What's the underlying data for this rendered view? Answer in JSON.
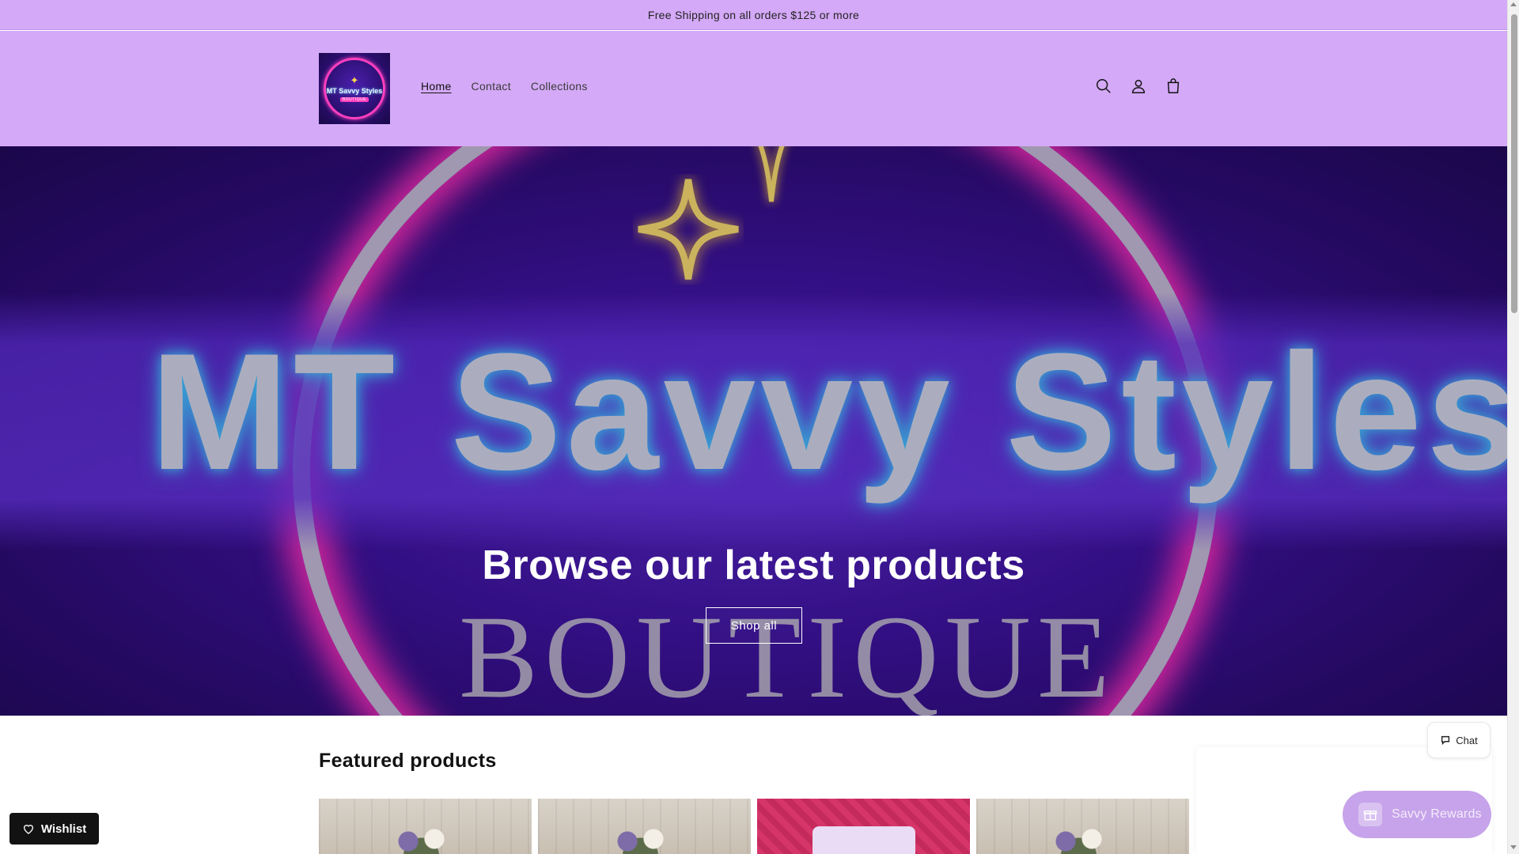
{
  "announcement": {
    "text": "Free Shipping on all orders $125 or more"
  },
  "header": {
    "logo": {
      "brand": "MT Savvy Styles",
      "sub": "BOUTIQUE"
    },
    "nav": [
      {
        "label": "Home",
        "active": true
      },
      {
        "label": "Contact",
        "active": false
      },
      {
        "label": "Collections",
        "active": false
      }
    ],
    "icons": [
      "search-icon",
      "account-icon",
      "cart-icon"
    ]
  },
  "hero": {
    "brand_text": "MT Savvy  Styles",
    "boutique_text": "BOUTIQUE",
    "heading": "Browse our latest products",
    "button_label": "Shop all"
  },
  "featured": {
    "title": "Featured products",
    "products": [
      {
        "icon": "product-image"
      },
      {
        "icon": "product-image"
      },
      {
        "icon": "product-image"
      },
      {
        "icon": "product-image"
      }
    ]
  },
  "widgets": {
    "chat_label": "Chat",
    "rewards_label": "Savvy Rewards",
    "wishlist_label": "Wishlist"
  },
  "colors": {
    "header_bg": "#d4a9f7",
    "hero_purple": "#3d139c",
    "neon_pink": "#ff2fb7",
    "neon_blue": "#43c8ff",
    "rewards_bg": "#c6a3ea",
    "wishlist_bg": "#121212"
  }
}
